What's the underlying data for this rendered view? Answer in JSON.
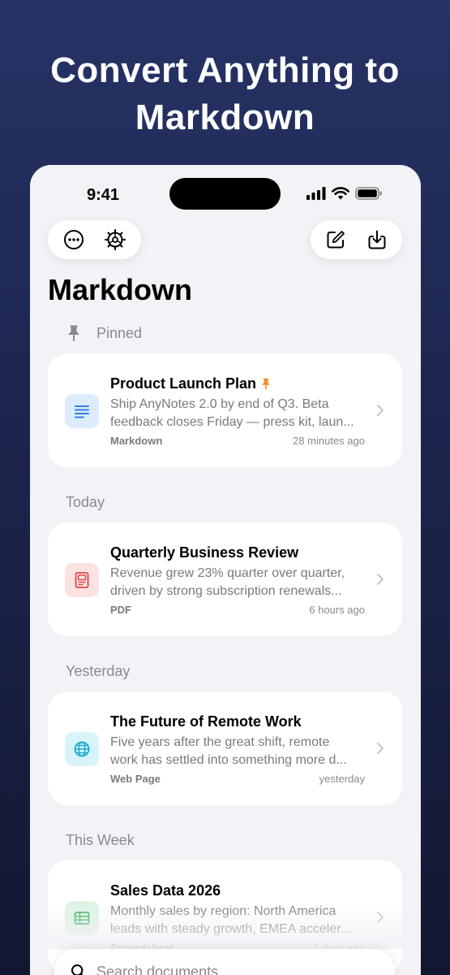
{
  "headline": {
    "line1": "Convert Anything to",
    "line2": "Markdown"
  },
  "status_bar": {
    "time": "9:41"
  },
  "toolbar": {
    "left": [
      "more-icon",
      "settings-icon"
    ],
    "right": [
      "compose-icon",
      "import-icon"
    ]
  },
  "page_title": "Markdown",
  "sections": [
    {
      "header": "Pinned",
      "items": [
        {
          "title": "Product Launch Plan",
          "pinned": true,
          "preview_line1": "Ship AnyNotes 2.0 by end of Q3. Beta",
          "preview_line2": "feedback closes Friday — press kit, laun...",
          "kind": "Markdown",
          "time": "28 minutes ago",
          "icon": "markdown-doc-icon",
          "icon_bg": "#dcecfd",
          "icon_color": "#2f80e8"
        }
      ]
    },
    {
      "header": "Today",
      "items": [
        {
          "title": "Quarterly Business Review",
          "preview_line1": "Revenue grew 23% quarter over quarter,",
          "preview_line2": "driven by strong subscription renewals...",
          "kind": "PDF",
          "time": "6 hours ago",
          "icon": "pdf-doc-icon",
          "icon_bg": "#fde2e2",
          "icon_color": "#e04646"
        }
      ]
    },
    {
      "header": "Yesterday",
      "items": [
        {
          "title": "The Future of Remote Work",
          "preview_line1": "Five years after the great shift, remote",
          "preview_line2": "work has settled into something more d...",
          "kind": "Web Page",
          "time": "yesterday",
          "icon": "globe-icon",
          "icon_bg": "#d9f3fb",
          "icon_color": "#19a7cf"
        }
      ]
    },
    {
      "header": "This Week",
      "items": [
        {
          "title": "Sales Data 2026",
          "preview_line1": "Monthly sales by region: North America",
          "preview_line2": "leads with steady growth, EMEA acceler...",
          "kind": "Spreadsheet",
          "time": "3 days ago",
          "icon": "spreadsheet-icon",
          "icon_bg": "#ddf3e2",
          "icon_color": "#31b15a"
        }
      ]
    }
  ],
  "search": {
    "placeholder": "Search documents",
    "value": ""
  },
  "colors": {
    "pin_accent": "#f5892a",
    "background": "#1d2650"
  }
}
